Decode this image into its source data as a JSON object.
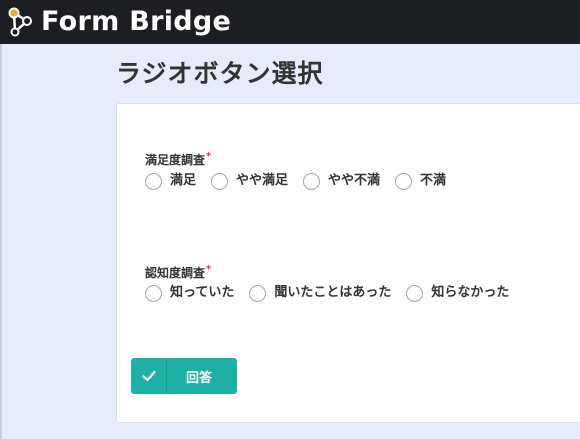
{
  "header": {
    "brand": "Form Bridge",
    "logo_icon": "form-bridge-logo-icon"
  },
  "page": {
    "title": "ラジオボタン選択"
  },
  "form": {
    "questions": [
      {
        "label": "満足度調査",
        "required_mark": "*",
        "options": [
          "満足",
          "やや満足",
          "やや不満",
          "不満"
        ]
      },
      {
        "label": "認知度調査",
        "required_mark": "*",
        "options": [
          "知っていた",
          "聞いたことはあった",
          "知らなかった"
        ]
      }
    ],
    "submit": {
      "label": "回答",
      "icon": "check-icon"
    }
  },
  "colors": {
    "topbar": "#1d1e22",
    "page_background": "#e8ecfa",
    "submit_button": "#1fb0a5",
    "required": "#e53935",
    "logo_accent": "#f5a623"
  }
}
